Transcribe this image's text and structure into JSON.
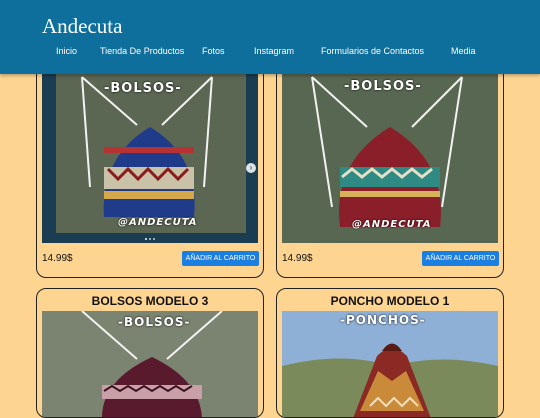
{
  "site": {
    "title": "Andecuta"
  },
  "nav": [
    {
      "label": "Inicio"
    },
    {
      "label": "Tienda De Productos"
    },
    {
      "label": "Fotos"
    },
    {
      "label": "Instagram"
    },
    {
      "label": "Formularios de Contactos"
    },
    {
      "label": "Media"
    }
  ],
  "products": [
    {
      "title": "",
      "price": "14.99$",
      "cart": "AÑADIR AL CARRITO",
      "banner": "-BOLSOS-",
      "tag": "@ANDECUTA"
    },
    {
      "title": "",
      "price": "14.99$",
      "cart": "AÑADIR AL CARRITO",
      "banner": "-BOLSOS-",
      "tag": "@ANDECUTA"
    },
    {
      "title": "BOLSOS MODELO 3",
      "banner": "-BOLSOS-"
    },
    {
      "title": "PONCHO MODELO 1",
      "banner": "-PONCHOS-"
    }
  ],
  "colors": {
    "header": "#0e6f9c",
    "page": "#fdd591",
    "cart_button": "#1a7fe0"
  },
  "icons": {
    "carousel_next": "chevron-right-icon"
  }
}
